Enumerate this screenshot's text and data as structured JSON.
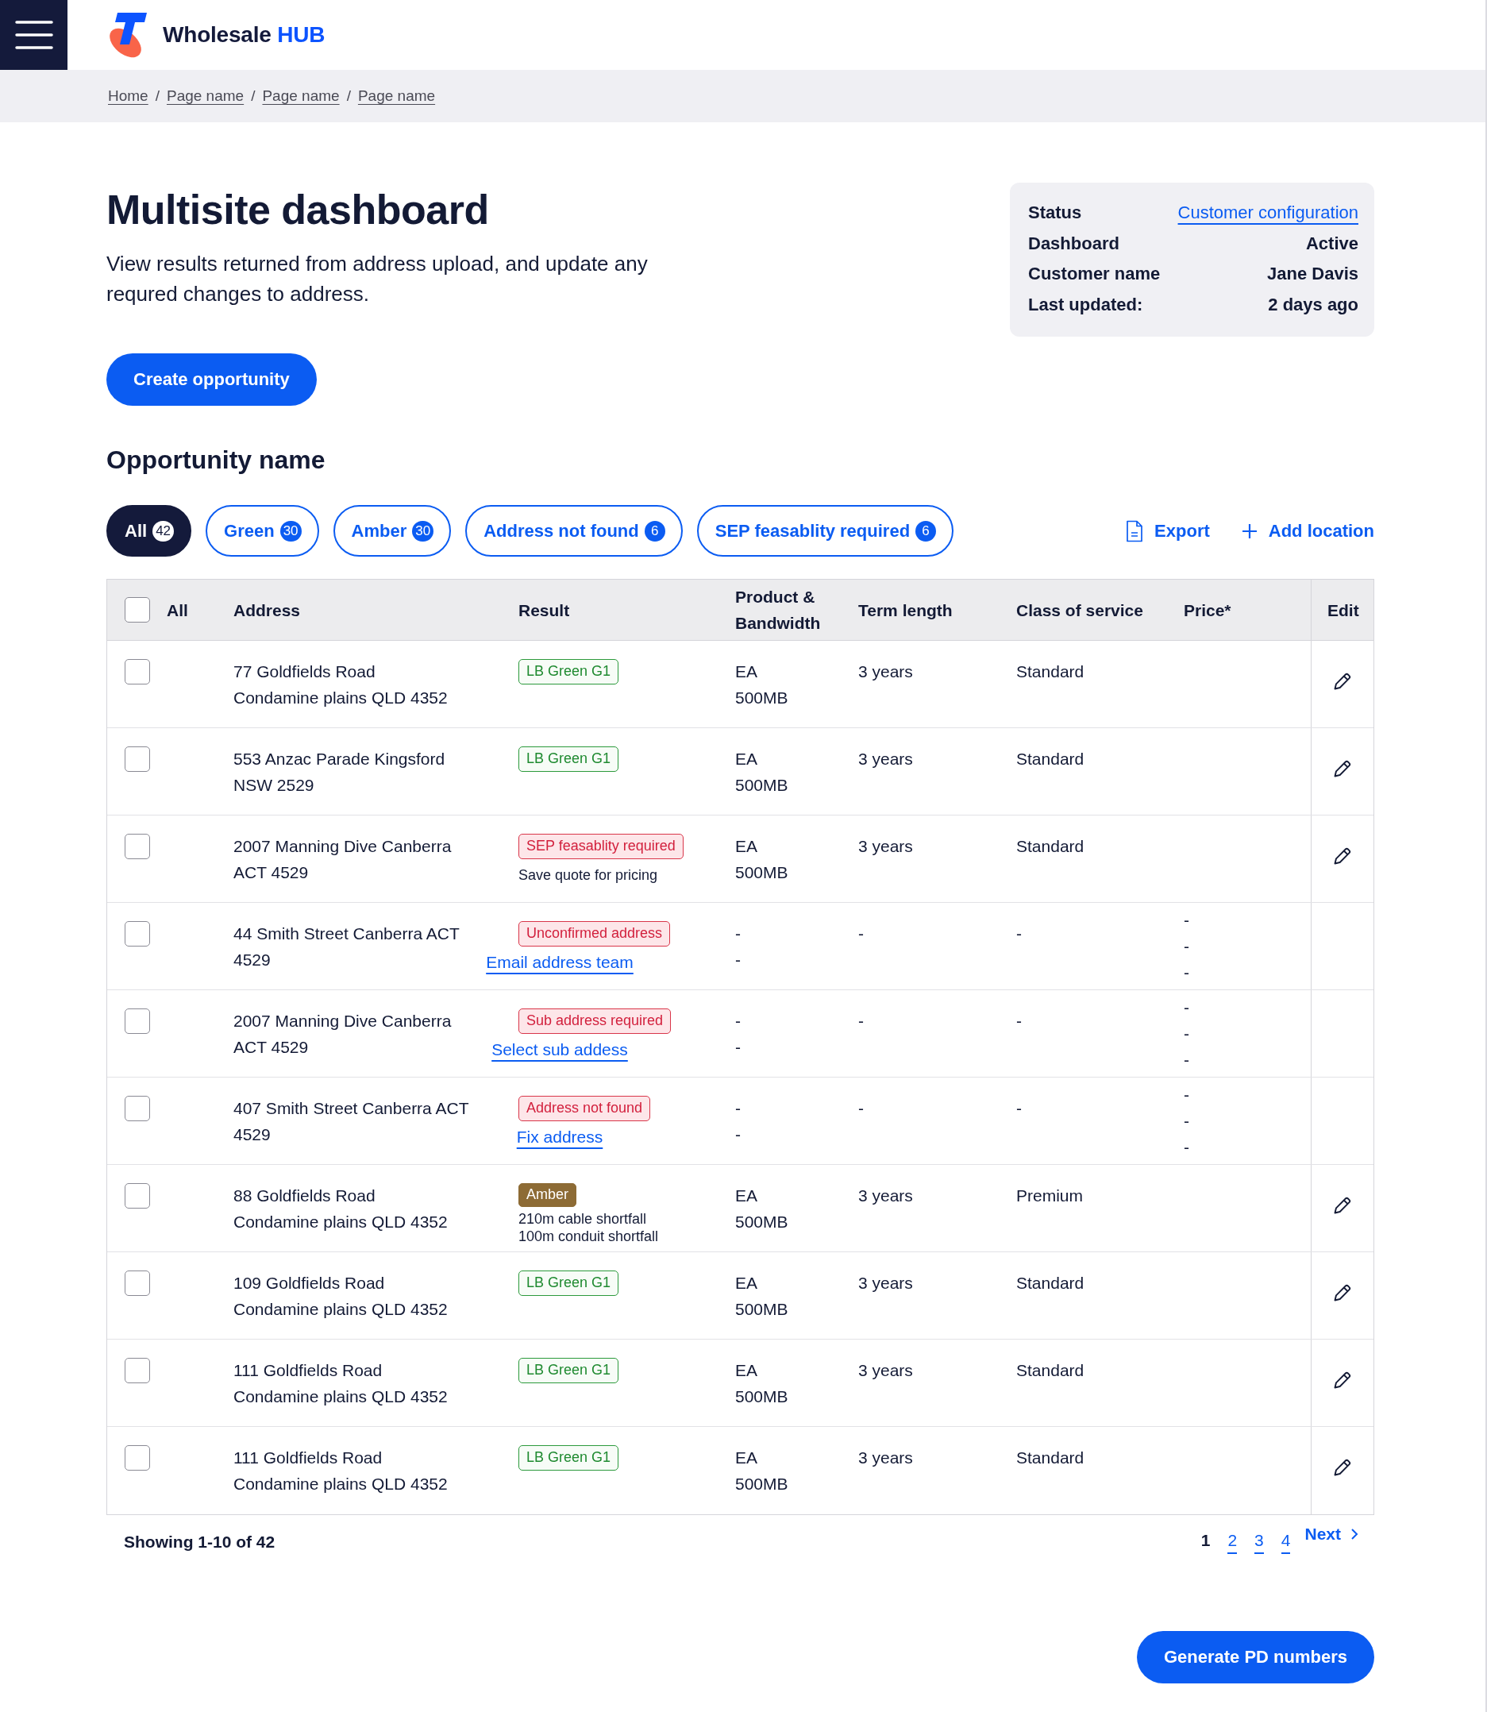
{
  "header": {
    "brand": {
      "name": "Wholesale",
      "highlight": "HUB"
    }
  },
  "breadcrumbs": [
    {
      "label": "Home"
    },
    {
      "separator": "/",
      "label": "Page name"
    },
    {
      "separator": "/",
      "label": "Page name"
    },
    {
      "separator": "/",
      "label": "Page name"
    }
  ],
  "page": {
    "title": "Multisite dashboard",
    "description": "View results returned from address upload, and update any requred changes to address.",
    "primary_button": "Create opportunity"
  },
  "status_card": {
    "rows": [
      {
        "label": "Status",
        "value": "Customer configuration",
        "kind": "link"
      },
      {
        "label": "Dashboard",
        "value": "Active",
        "kind": "text"
      },
      {
        "label": "Customer name",
        "value": "Jane Davis",
        "kind": "text"
      },
      {
        "label": "Last updated:",
        "value": "2 days ago",
        "kind": "text"
      }
    ]
  },
  "opportunity": {
    "title": "Opportunity name"
  },
  "filters": [
    {
      "label": "All",
      "count": "42",
      "selected": true
    },
    {
      "label": "Green",
      "count": "30",
      "selected": false
    },
    {
      "label": "Amber",
      "count": "30",
      "selected": false
    },
    {
      "label": "Address not found",
      "count": "6",
      "selected": false
    },
    {
      "label": "SEP feasablity required",
      "count": "6",
      "selected": false
    }
  ],
  "actions": [
    {
      "label": "Export",
      "kind": "export"
    },
    {
      "label": "Add location",
      "kind": "add"
    }
  ],
  "table": {
    "select_all": {
      "checked": false
    },
    "columns": [
      "All",
      "Address",
      "Result",
      "Product & Bandwidth",
      "Term length",
      "Class of service",
      "Price*",
      "Edit"
    ],
    "rows": [
      {
        "checked": false,
        "address": [
          "77 Goldfields Road",
          "Condamine plains QLD 4352"
        ],
        "result": {
          "tag": "LB Green G1",
          "kind": "green"
        },
        "product": [
          "EA",
          "500MB"
        ],
        "term": "3 years",
        "service_class": "Standard",
        "editable": true
      },
      {
        "checked": false,
        "address": [
          "553 Anzac Parade Kingsford",
          "NSW 2529"
        ],
        "result": {
          "tag": "LB Green G1",
          "kind": "green"
        },
        "product": [
          "EA",
          "500MB"
        ],
        "term": "3 years",
        "service_class": "Standard",
        "editable": true
      },
      {
        "checked": false,
        "address": [
          "2007 Manning Dive Canberra",
          "ACT 4529"
        ],
        "result": {
          "tag": "SEP feasablity required",
          "kind": "alert",
          "notes": [
            "Save quote for pricing"
          ]
        },
        "product": [
          "EA",
          "500MB"
        ],
        "term": "3 years",
        "service_class": "Standard",
        "editable": true
      },
      {
        "checked": false,
        "address": [
          "44 Smith Street Canberra ACT",
          "4529"
        ],
        "result": {
          "tag": "Unconfirmed address",
          "kind": "alert",
          "link": "Email address team"
        },
        "product": [
          "-",
          "-"
        ],
        "term": "-",
        "service_class": "-",
        "price": [
          "-",
          "-",
          "-"
        ],
        "editable": false
      },
      {
        "checked": false,
        "address": [
          "2007 Manning Dive Canberra",
          "ACT 4529"
        ],
        "result": {
          "tag": "Sub address required",
          "kind": "alert",
          "link": "Select sub addess"
        },
        "product": [
          "-",
          "-"
        ],
        "term": "-",
        "service_class": "-",
        "price": [
          "-",
          "-",
          "-"
        ],
        "editable": false
      },
      {
        "checked": false,
        "address": [
          "407 Smith Street Canberra ACT",
          "4529"
        ],
        "result": {
          "tag": "Address not found",
          "kind": "alert",
          "link": "Fix address"
        },
        "product": [
          "-",
          "-"
        ],
        "term": "-",
        "service_class": "-",
        "price": [
          "-",
          "-",
          "-"
        ],
        "editable": false
      },
      {
        "checked": false,
        "address": [
          "88 Goldfields Road",
          "Condamine plains QLD 4352"
        ],
        "result": {
          "tag": "Amber",
          "kind": "amber",
          "notes": [
            "210m cable shortfall",
            "100m conduit shortfall"
          ]
        },
        "product": [
          "EA",
          "500MB"
        ],
        "term": "3 years",
        "service_class": "Premium",
        "editable": true
      },
      {
        "checked": false,
        "address": [
          "109 Goldfields Road",
          "Condamine plains QLD 4352"
        ],
        "result": {
          "tag": "LB Green G1",
          "kind": "green"
        },
        "product": [
          "EA",
          "500MB"
        ],
        "term": "3 years",
        "service_class": "Standard",
        "editable": true
      },
      {
        "checked": false,
        "address": [
          "111 Goldfields Road",
          "Condamine plains QLD 4352"
        ],
        "result": {
          "tag": "LB Green G1",
          "kind": "green"
        },
        "product": [
          "EA",
          "500MB"
        ],
        "term": "3 years",
        "service_class": "Standard",
        "editable": true
      },
      {
        "checked": false,
        "address": [
          "111 Goldfields Road",
          "Condamine plains QLD 4352"
        ],
        "result": {
          "tag": "LB Green G1",
          "kind": "green"
        },
        "product": [
          "EA",
          "500MB"
        ],
        "term": "3 years",
        "service_class": "Standard",
        "editable": true
      }
    ]
  },
  "pagination": {
    "summary": "Showing 1-10 of 42",
    "pages": [
      {
        "label": "1",
        "selected": true
      },
      {
        "label": "2",
        "selected": false
      },
      {
        "label": "3",
        "selected": false
      },
      {
        "label": "4",
        "selected": false
      }
    ],
    "next": "Next"
  },
  "footer": {
    "button": "Generate PD numbers"
  }
}
